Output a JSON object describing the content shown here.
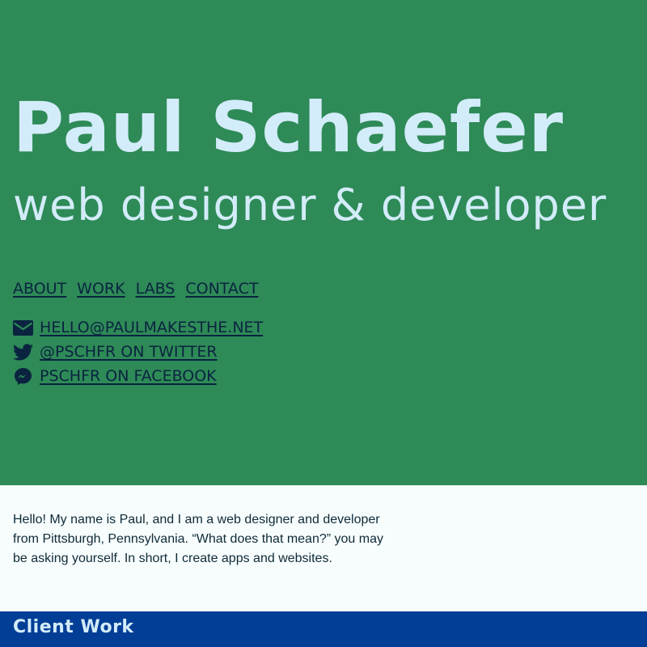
{
  "hero": {
    "name": "Paul Schaefer",
    "tagline": "web designer & developer"
  },
  "nav": {
    "items": [
      {
        "label": "ABOUT"
      },
      {
        "label": "WORK"
      },
      {
        "label": "LABS"
      },
      {
        "label": "CONTACT"
      }
    ]
  },
  "contact": {
    "email": {
      "label": "HELLO@PAULMAKESTHE.NET",
      "icon": "envelope-icon"
    },
    "twitter": {
      "label": "@PSCHFR ON TWITTER",
      "icon": "twitter-icon"
    },
    "facebook": {
      "label": "PSCHFR ON FACEBOOK",
      "icon": "messenger-icon"
    }
  },
  "intro": {
    "text": "Hello! My name is Paul, and I am a web designer and developer from Pittsburgh, Pennsylvania. “What does that mean?” you may be asking yourself. In short, I create apps and websites."
  },
  "client_work": {
    "heading": "Client Work"
  },
  "colors": {
    "hero_bg": "#2e8a57",
    "hero_text": "#d3ecf9",
    "link": "#0a2440",
    "section_bg": "#023e96"
  }
}
